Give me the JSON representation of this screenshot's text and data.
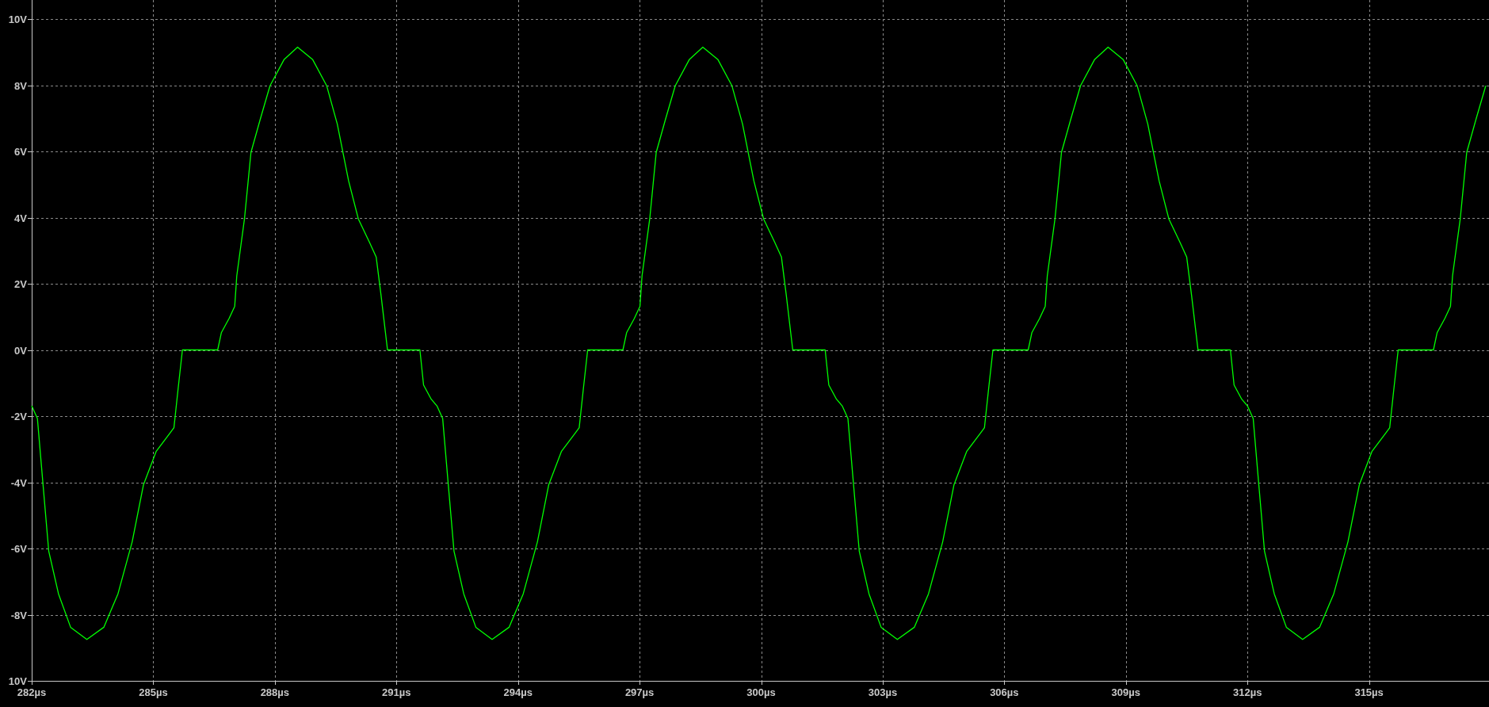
{
  "plot": {
    "chart_data": {
      "type": "line",
      "grid": true,
      "xlim": [
        282,
        317.96
      ],
      "ylim": [
        -10,
        10
      ],
      "xticks": [
        {
          "value": 282,
          "label": "282µs"
        },
        {
          "value": 285,
          "label": "285µs"
        },
        {
          "value": 288,
          "label": "288µs"
        },
        {
          "value": 291,
          "label": "291µs"
        },
        {
          "value": 294,
          "label": "294µs"
        },
        {
          "value": 297,
          "label": "297µs"
        },
        {
          "value": 300,
          "label": "300µs"
        },
        {
          "value": 303,
          "label": "303µs"
        },
        {
          "value": 306,
          "label": "306µs"
        },
        {
          "value": 309,
          "label": "309µs"
        },
        {
          "value": 312,
          "label": "312µs"
        },
        {
          "value": 315,
          "label": "315µs"
        }
      ],
      "yticks": [
        {
          "value": 10,
          "label": "10V"
        },
        {
          "value": 8,
          "label": "8V"
        },
        {
          "value": 6,
          "label": "6V"
        },
        {
          "value": 4,
          "label": "4V"
        },
        {
          "value": 2,
          "label": "2V"
        },
        {
          "value": 0,
          "label": "0V"
        },
        {
          "value": -2,
          "label": "-2V"
        },
        {
          "value": -4,
          "label": "-4V"
        },
        {
          "value": -6,
          "label": "-6V"
        },
        {
          "value": -8,
          "label": "-8V"
        },
        {
          "value": -10,
          "label": "10V"
        }
      ],
      "x": [
        282,
        282.14,
        282.28,
        282.42,
        282.66,
        282.96,
        283.36,
        283.78,
        284.13,
        284.48,
        284.76,
        285.07,
        285.42,
        285.51,
        285.61,
        285.72,
        286.59,
        286.68,
        286.87,
        287.01,
        287.06,
        287.25,
        287.41,
        287.64,
        287.88,
        288.23,
        288.56,
        288.93,
        289.28,
        289.54,
        289.82,
        290.06,
        290.34,
        290.5,
        290.62,
        290.78,
        291.58,
        291.67,
        291.86,
        292,
        292.14,
        292.28,
        292.42,
        292.66,
        292.96,
        293.36,
        293.78,
        294.13,
        294.48,
        294.76,
        295.07,
        295.42,
        295.51,
        295.61,
        295.72,
        296.59,
        296.68,
        296.87,
        297.01,
        297.06,
        297.25,
        297.41,
        297.64,
        297.88,
        298.23,
        298.56,
        298.93,
        299.28,
        299.54,
        299.82,
        300.06,
        300.34,
        300.5,
        300.62,
        300.78,
        301.58,
        301.67,
        301.86,
        302,
        302.14,
        302.28,
        302.42,
        302.66,
        302.96,
        303.36,
        303.78,
        304.13,
        304.48,
        304.76,
        305.07,
        305.42,
        305.51,
        305.61,
        305.72,
        306.59,
        306.68,
        306.87,
        307.01,
        307.06,
        307.25,
        307.41,
        307.64,
        307.88,
        308.23,
        308.56,
        308.93,
        309.28,
        309.54,
        309.82,
        310.06,
        310.34,
        310.5,
        310.62,
        310.78,
        311.58,
        311.67,
        311.86,
        312,
        312.14,
        312.28,
        312.42,
        312.66,
        312.96,
        313.36,
        313.78,
        314.13,
        314.48,
        314.76,
        315.07,
        315.42,
        315.51,
        315.61,
        315.72,
        316.59,
        316.68,
        316.87,
        317.01,
        317.06,
        317.25,
        317.41,
        317.64,
        317.88
      ],
      "series": [
        {
          "color": "#00ff00",
          "values": [
            -1.69,
            -2.07,
            -4.07,
            -6.08,
            -7.37,
            -8.38,
            -8.75,
            -8.38,
            -7.37,
            -5.8,
            -4.07,
            -3.07,
            -2.5,
            -2.35,
            -1.21,
            0,
            0,
            0.52,
            0.95,
            1.32,
            2.24,
            3.96,
            5.97,
            6.97,
            7.98,
            8.78,
            9.15,
            8.78,
            7.98,
            6.83,
            5.11,
            3.96,
            3.24,
            2.81,
            1.66,
            0,
            0,
            -1.06,
            -1.49,
            -1.69,
            -2.07,
            -4.07,
            -6.08,
            -7.37,
            -8.38,
            -8.75,
            -8.38,
            -7.37,
            -5.8,
            -4.07,
            -3.07,
            -2.5,
            -2.35,
            -1.21,
            0,
            0,
            0.52,
            0.95,
            1.32,
            2.24,
            3.96,
            5.97,
            6.97,
            7.98,
            8.78,
            9.15,
            8.78,
            7.98,
            6.83,
            5.11,
            3.96,
            3.24,
            2.81,
            1.66,
            0,
            0,
            -1.06,
            -1.49,
            -1.69,
            -2.07,
            -4.07,
            -6.08,
            -7.37,
            -8.38,
            -8.75,
            -8.38,
            -7.37,
            -5.8,
            -4.07,
            -3.07,
            -2.5,
            -2.35,
            -1.21,
            0,
            0,
            0.52,
            0.95,
            1.32,
            2.24,
            3.96,
            5.97,
            6.97,
            7.98,
            8.78,
            9.15,
            8.78,
            7.98,
            6.83,
            5.11,
            3.96,
            3.24,
            2.81,
            1.66,
            0,
            0,
            -1.06,
            -1.49,
            -1.69,
            -2.07,
            -4.07,
            -6.08,
            -7.37,
            -8.38,
            -8.75,
            -8.38,
            -7.37,
            -5.8,
            -4.07,
            -3.07,
            -2.5,
            -2.35,
            -1.21,
            0,
            0,
            0.52,
            0.95,
            1.32,
            2.24,
            3.96,
            5.97,
            6.97,
            7.98
          ]
        }
      ]
    }
  }
}
